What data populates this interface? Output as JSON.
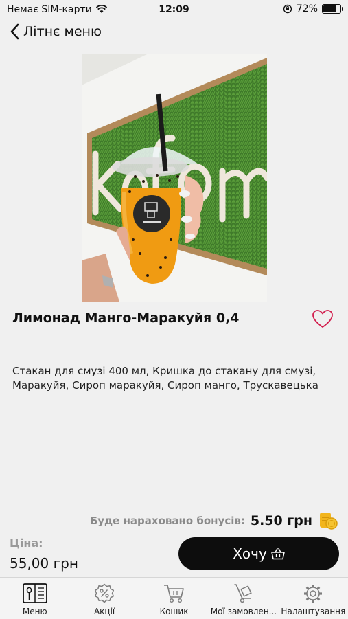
{
  "status": {
    "carrier": "Немає SIM-карти",
    "time": "12:09",
    "battery": "72%",
    "battery_level": 0.72
  },
  "nav": {
    "back_label": "Літнє меню"
  },
  "product": {
    "photo_text": "kofem",
    "title": "Лимонад Манго-Маракуйя 0,4",
    "description": "Стакан для смузі 400 мл, Кришка до стакану для смузі, Маракуйя, Сироп маракуйя, Сироп манго, Трускавецька",
    "bonus_label": "Буде нараховано бонусів:",
    "bonus_value": "5.50 грн",
    "price_label": "Ціна:",
    "price_value": "55,00 грн",
    "button_label": "Хочу"
  },
  "tabs": [
    {
      "label": "Меню",
      "icon": "menu-book-icon",
      "active": true
    },
    {
      "label": "Акції",
      "icon": "percent-badge-icon",
      "active": false
    },
    {
      "label": "Кошик",
      "icon": "cart-icon",
      "active": false
    },
    {
      "label": "Мої замовлен...",
      "icon": "hand-truck-icon",
      "active": false
    },
    {
      "label": "Налаштування",
      "icon": "gear-icon",
      "active": false
    }
  ]
}
